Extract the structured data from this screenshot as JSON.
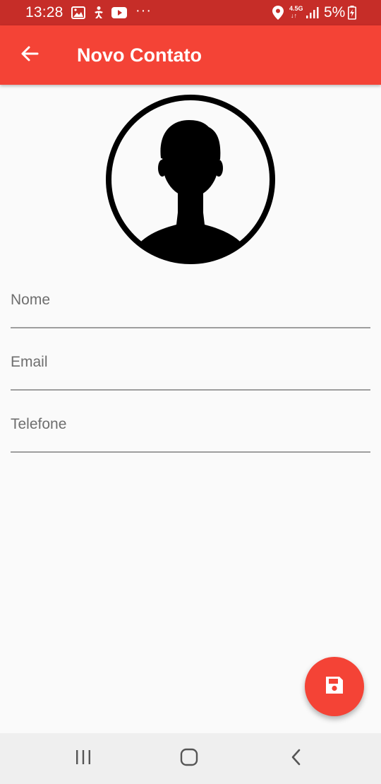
{
  "status_bar": {
    "time": "13:28",
    "network": "4.5G",
    "battery": "5%",
    "icons": [
      "gallery-icon",
      "accessibility-icon",
      "youtube-icon",
      "more-icon",
      "location-icon",
      "signal-icon",
      "battery-charging-icon"
    ]
  },
  "app_bar": {
    "title": "Novo Contato",
    "back_icon": "arrow-back-icon",
    "color": "#f44336"
  },
  "avatar": {
    "icon": "person-silhouette-icon"
  },
  "form": {
    "fields": [
      {
        "label": "Nome"
      },
      {
        "label": "Email"
      },
      {
        "label": "Telefone"
      }
    ]
  },
  "fab": {
    "icon": "save-icon",
    "color": "#f44336"
  },
  "nav_bar": {
    "icons": [
      "recent-apps-icon",
      "home-icon",
      "back-icon"
    ]
  }
}
